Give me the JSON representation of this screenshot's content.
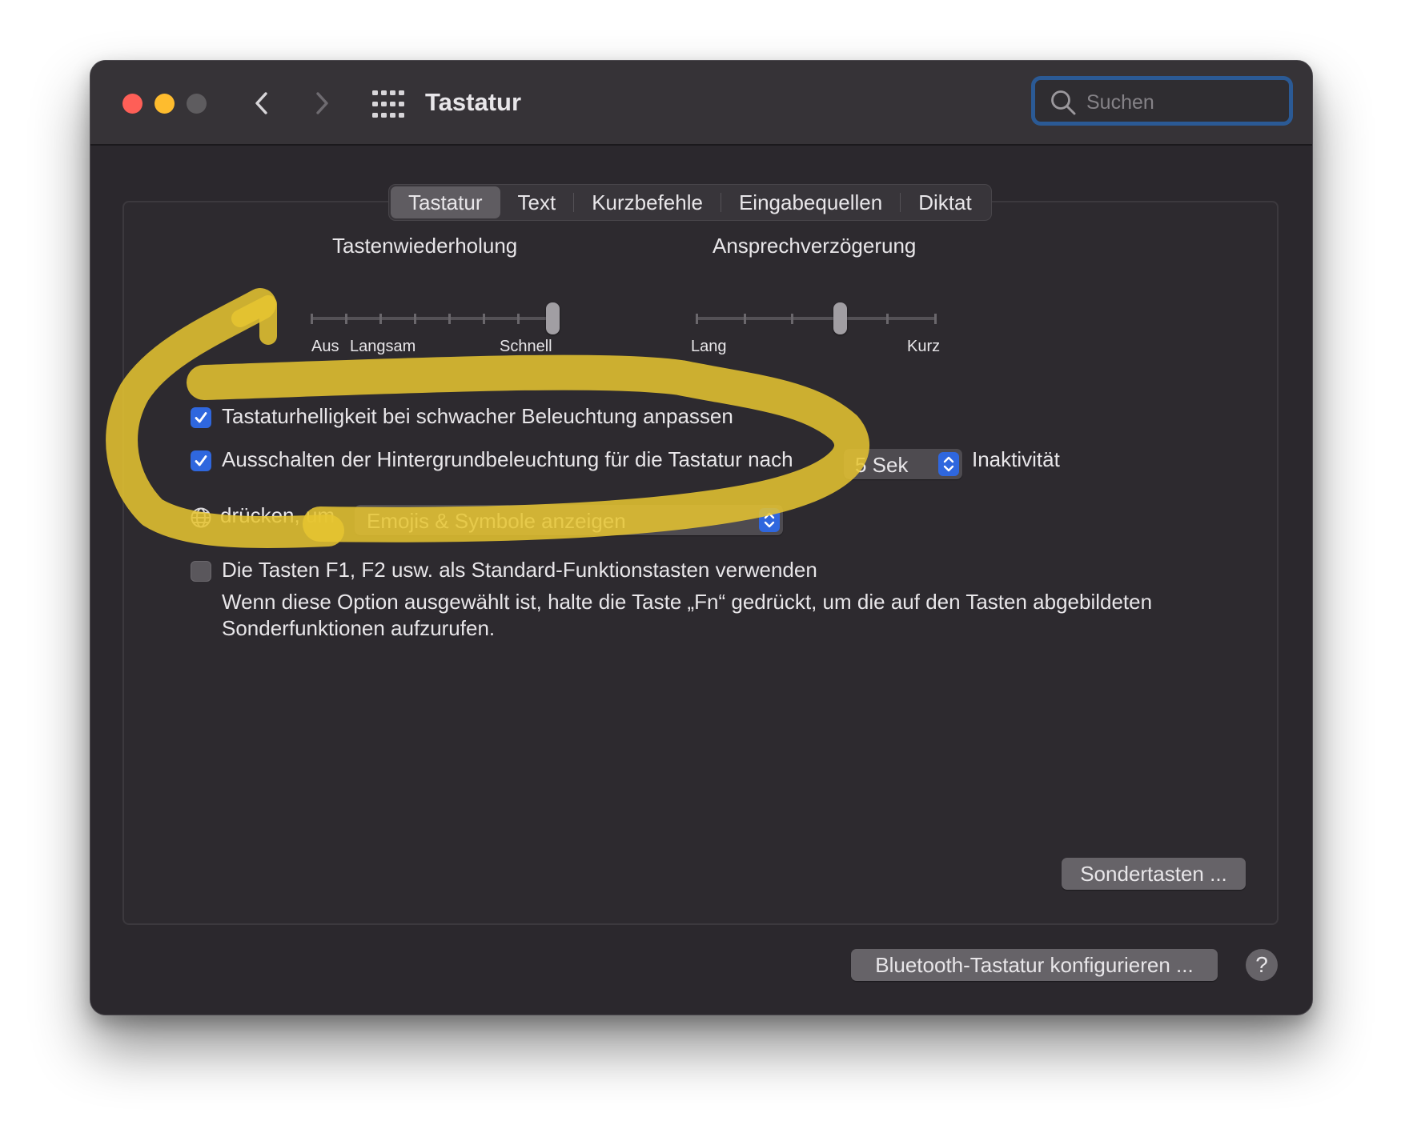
{
  "window": {
    "title": "Tastatur",
    "search": {
      "placeholder": "Suchen",
      "value": ""
    }
  },
  "tabs": [
    {
      "label": "Tastatur",
      "selected": true
    },
    {
      "label": "Text",
      "selected": false
    },
    {
      "label": "Kurzbefehle",
      "selected": false
    },
    {
      "label": "Eingabequellen",
      "selected": false
    },
    {
      "label": "Diktat",
      "selected": false
    }
  ],
  "key_repeat": {
    "title": "Tastenwiederholung",
    "labels": {
      "off": "Aus",
      "slow": "Langsam",
      "fast": "Schnell"
    },
    "tick_count": 8,
    "position": 7
  },
  "delay_until_repeat": {
    "title": "Ansprechverzögerung",
    "labels": {
      "long": "Lang",
      "short": "Kurz"
    },
    "tick_count": 6,
    "position": 3
  },
  "options": {
    "adjust_brightness": {
      "label": "Tastaturhelligkeit bei schwacher Beleuchtung anpassen",
      "checked": true
    },
    "backlight_off": {
      "label": "Ausschalten der Hintergrundbeleuchtung für die Tastatur nach",
      "checked": true,
      "popup_value": "5 Sek",
      "suffix": "Inaktivität"
    },
    "globe_key": {
      "prefix": "drücken, um",
      "popup_value": "Emojis & Symbole anzeigen"
    },
    "function_keys": {
      "label": "Die Tasten F1, F2 usw. als Standard-Funktionstasten verwenden",
      "checked": false,
      "description": "Wenn diese Option ausgewählt ist, halte die Taste „Fn“ gedrückt, um die auf den Tasten abgebildeten Sonderfunktionen aufzurufen."
    }
  },
  "buttons": {
    "modifier_keys": "Sondertasten ...",
    "bluetooth": "Bluetooth-Tastatur konfigurieren ...",
    "help": "?"
  },
  "colors": {
    "accent": "#2f67de",
    "annotation": "#e6c531",
    "close": "#fe5f57",
    "minimize": "#febc2e"
  }
}
